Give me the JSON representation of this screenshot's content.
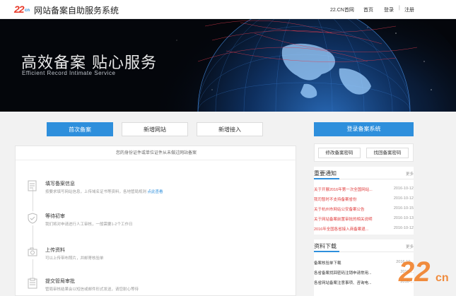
{
  "header": {
    "logo_main": "22",
    "logo_sub": "cn",
    "title": "网站备案自助服务系统",
    "nav": {
      "home_brand": "22.CN首网",
      "home": "首页",
      "login": "登录",
      "separator": "|",
      "register": "注册"
    }
  },
  "banner": {
    "slogan": "高效备案 贴心服务",
    "slogan_en": "Efficient  Record Intimate Service"
  },
  "tabs": [
    {
      "label": "首次备案",
      "active": true
    },
    {
      "label": "新增网站",
      "active": false
    },
    {
      "label": "新增接入",
      "active": false
    }
  ],
  "main": {
    "hint": "您的身份证件或单位证件从未做过网站备案",
    "steps": [
      {
        "icon": "document-icon",
        "title": "填写备案信息",
        "desc": "按要求填写网站信息，上传域名证书等资料，各地管局规则",
        "link": "点此查看"
      },
      {
        "icon": "shield-icon",
        "title": "等待初审",
        "desc": "我们将对申请进行人工审核，一般需要1-2个工作日",
        "link": ""
      },
      {
        "icon": "camera-icon",
        "title": "上传资料",
        "desc": "可以上传带布照片，并邮寄核验单",
        "link": ""
      },
      {
        "icon": "clipboard-icon",
        "title": "提交管局审批",
        "desc": "管局审核结果会以短信或邮件形式发送，请您耐心等待",
        "link": ""
      }
    ]
  },
  "sidebar": {
    "login_button": "登录备案系统",
    "modify_password": "修改备案密码",
    "recover_password": "找回备案密码",
    "notices": {
      "title": "重要通知",
      "more": "更多",
      "items": [
        {
          "title": "关于开展2016年第一次全国网站...",
          "date": "2016-10-12"
        },
        {
          "title": "我司暂时不支持备案省份",
          "date": "2016-10-12"
        },
        {
          "title": "关于杭州市网站公安备案公告",
          "date": "2016-10-15"
        },
        {
          "title": "关于网站备案前置审批的相关说明",
          "date": "2016-10-13"
        },
        {
          "title": "2016年全国各省接入商备案退...",
          "date": "2016-10-12"
        }
      ]
    },
    "downloads": {
      "title": "资料下载",
      "more": "更多",
      "items": [
        {
          "title": "备案核验单下载",
          "date": "2016-10..."
        },
        {
          "title": "各省备案找回密码注销申请常用...",
          "date": "2016-..."
        },
        {
          "title": "各省网站备案注意事项、咨询电...",
          "date": "2016-..."
        }
      ]
    }
  },
  "colors": {
    "accent": "#2e8fdc",
    "news_red": "#e03a3a",
    "logo_red": "#e83a2a"
  }
}
